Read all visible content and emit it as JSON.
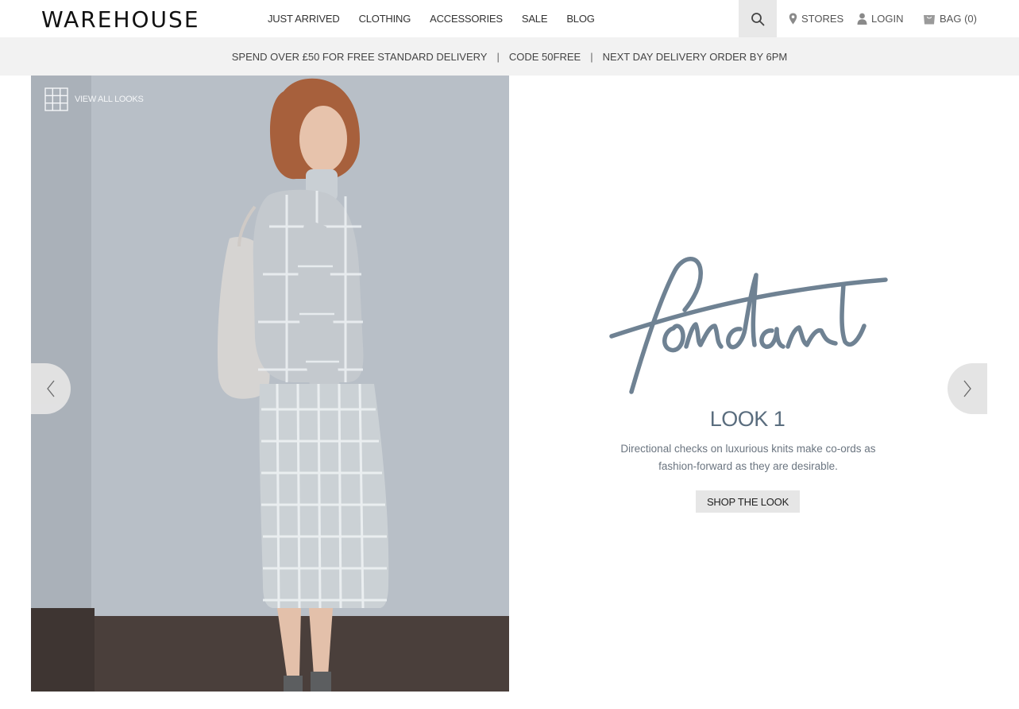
{
  "header": {
    "logo": "WAREHOUSE",
    "nav": [
      "JUST ARRIVED",
      "CLOTHING",
      "ACCESSORIES",
      "SALE",
      "BLOG"
    ],
    "stores_label": "STORES",
    "login_label": "LOGIN",
    "bag_label": "BAG (0)"
  },
  "promo": {
    "part1": "SPEND OVER £50 FOR FREE STANDARD DELIVERY",
    "part2": "CODE 50FREE",
    "part3": "NEXT DAY DELIVERY ORDER BY 6PM",
    "separator": "|"
  },
  "gallery": {
    "view_all_label": "VIEW ALL LOOKS"
  },
  "look": {
    "script_word": "fondant",
    "title": "LOOK 1",
    "desc_line1": "Directional checks on luxurious knits make co-ords as",
    "desc_line2": "fashion-forward as they are desirable.",
    "cta": "SHOP THE LOOK"
  },
  "colors": {
    "accent": "#5a6d7e",
    "script_ink": "#6f8293",
    "promo_bg": "#f2f2f2",
    "button_bg": "#e6e6e6"
  },
  "icons": [
    "search-icon",
    "map-pin-icon",
    "user-icon",
    "bag-icon",
    "grid-icon",
    "chevron-left-icon",
    "chevron-right-icon"
  ]
}
